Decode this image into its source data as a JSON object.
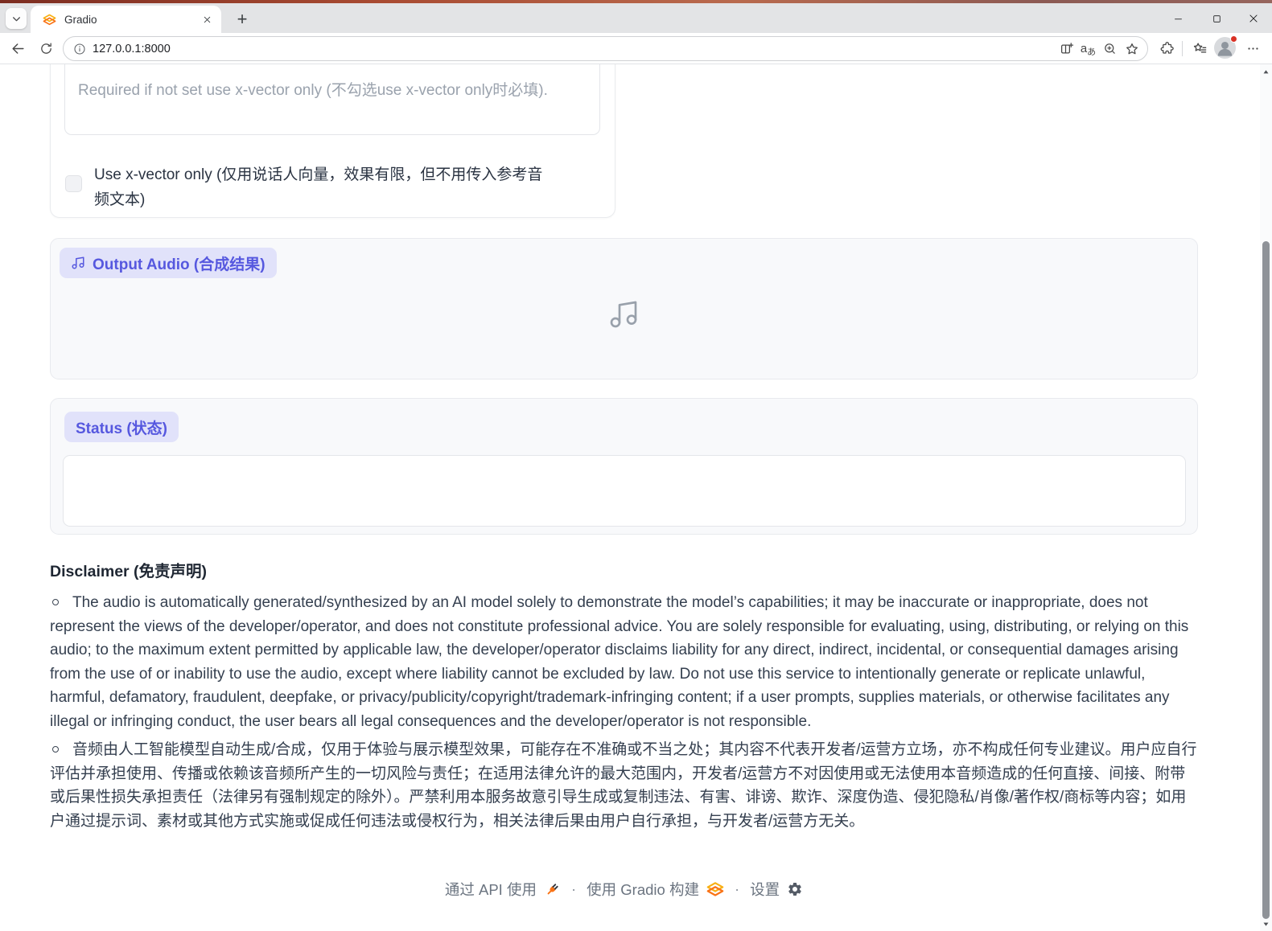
{
  "browser": {
    "tab_title": "Gradio",
    "url": "127.0.0.1:8000",
    "new_tab_glyph": "+",
    "translate_icon_text": {
      "latin": "a",
      "kana": "あ"
    }
  },
  "app": {
    "reference_text_input": {
      "value": "",
      "placeholder": "Required if not set use x-vector only (不勾选use x-vector only时必填)."
    },
    "xvector_checkbox": {
      "checked": false,
      "label": "Use x-vector only (仅用说话人向量，效果有限，但不用传入参考音频文本)"
    },
    "output_audio": {
      "label": "Output Audio (合成结果)"
    },
    "status": {
      "label": "Status (状态)",
      "value": ""
    }
  },
  "disclaimer": {
    "heading": "Disclaimer (免责声明)",
    "items": [
      "The audio is automatically generated/synthesized by an AI model solely to demonstrate the model’s capabilities; it may be inaccurate or inappropriate, does not represent the views of the developer/operator, and does not constitute professional advice. You are solely responsible for evaluating, using, distributing, or relying on this audio; to the maximum extent permitted by applicable law, the developer/operator disclaims liability for any direct, indirect, incidental, or consequential damages arising from the use of or inability to use the audio, except where liability cannot be excluded by law. Do not use this service to intentionally generate or replicate unlawful, harmful, defamatory, fraudulent, deepfake, or privacy/publicity/copyright/trademark-infringing content; if a user prompts, supplies materials, or otherwise facilitates any illegal or infringing conduct, the user bears all legal consequences and the developer/operator is not responsible.",
      "音频由人工智能模型自动生成/合成，仅用于体验与展示模型效果，可能存在不准确或不当之处；其内容不代表开发者/运营方立场，亦不构成任何专业建议。用户应自行评估并承担使用、传播或依赖该音频所产生的一切风险与责任；在适用法律允许的最大范围内，开发者/运营方不对因使用或无法使用本音频造成的任何直接、间接、附带或后果性损失承担责任（法律另有强制规定的除外）。严禁利用本服务故意引导生成或复制违法、有害、诽谤、欺诈、深度伪造、侵犯隐私/肖像/著作权/商标等内容；如用户通过提示词、素材或其他方式实施或促成任何违法或侵权行为，相关法律后果由用户自行承担，与开发者/运营方无关。"
    ]
  },
  "footer": {
    "use_via_api": "通过 API 使用",
    "separator": "·",
    "built_with_gradio": "使用 Gradio 构建",
    "settings": "设置"
  },
  "colors": {
    "accent_purple": "#5658df",
    "badge_bg": "#e1e2fa",
    "gradio_orange": "#f97316",
    "frame_red": "#a94b32"
  }
}
